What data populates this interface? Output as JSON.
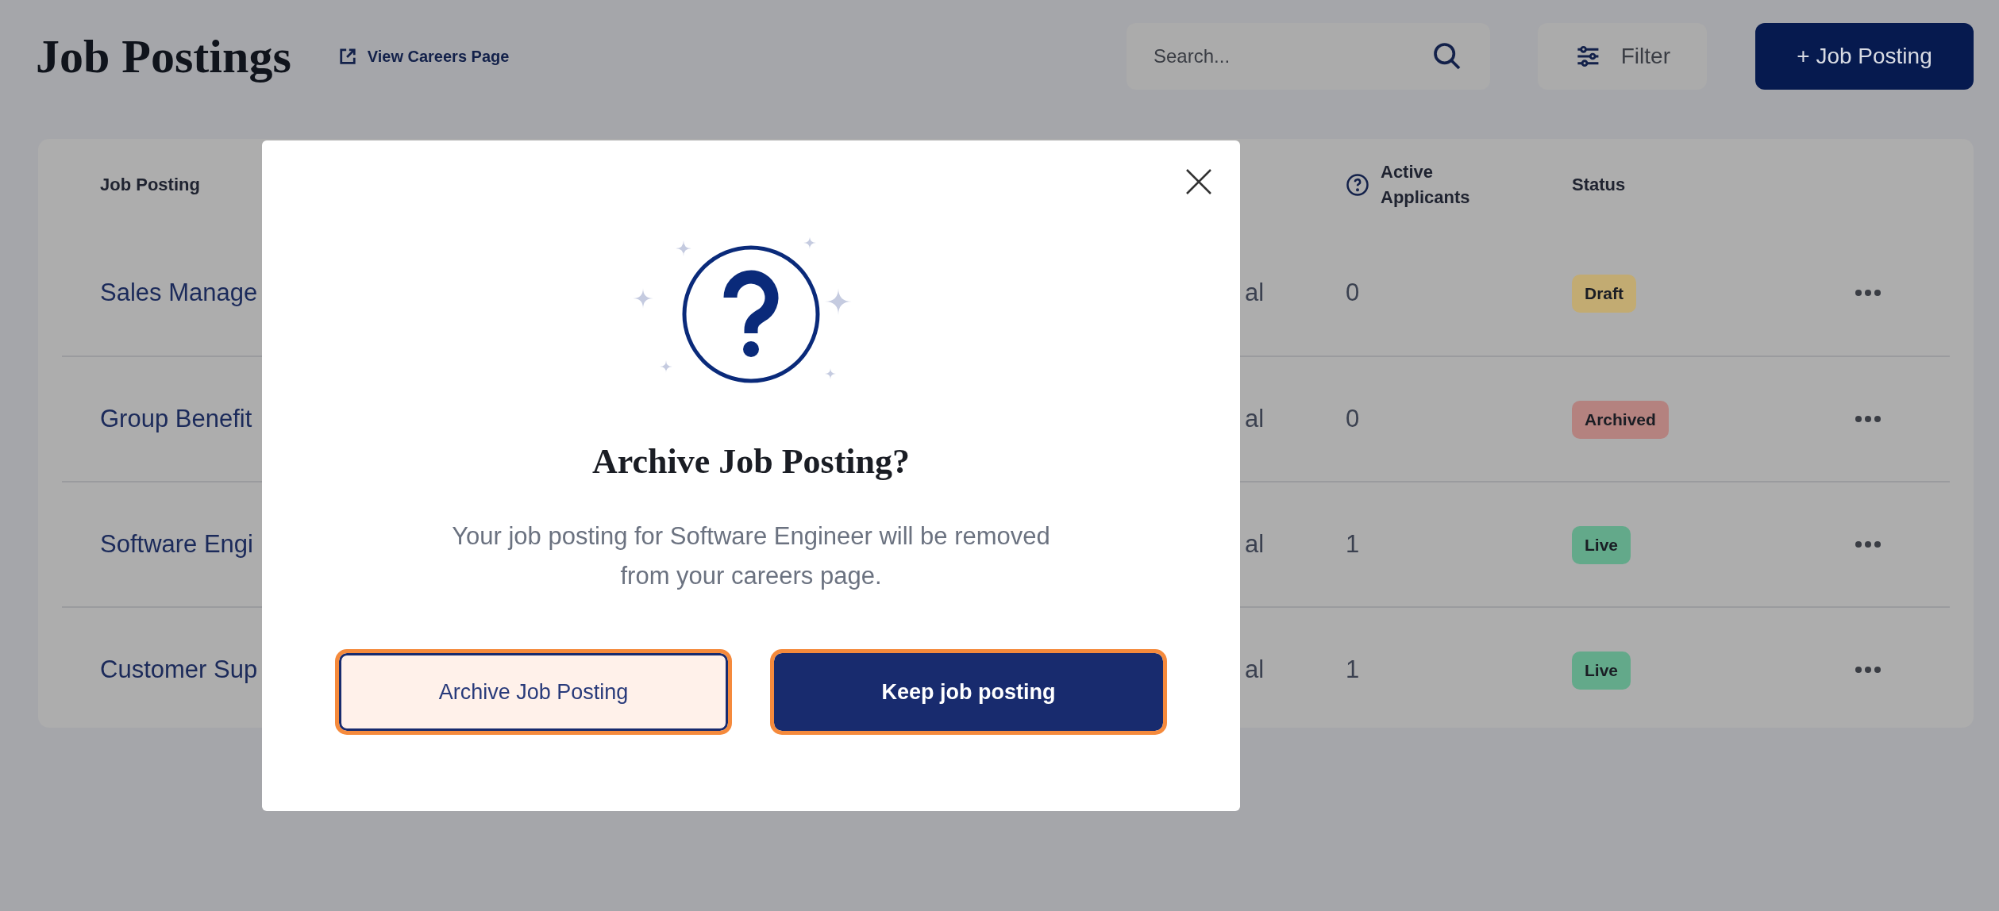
{
  "header": {
    "title": "Job Postings",
    "careers_link": "View Careers Page",
    "search": {
      "placeholder": "Search..."
    },
    "filter_button": "Filter",
    "add_button": "+ Job Posting"
  },
  "table": {
    "columns": [
      {
        "label": "Job Posting",
        "kind": "plain"
      },
      {
        "label": "Active Applicants",
        "kind": "help"
      },
      {
        "label": "Status",
        "kind": "plain"
      }
    ],
    "rows": [
      {
        "job_posting": "Sales Manage",
        "column_2": "al",
        "applicants": "0",
        "status": {
          "label": "Draft",
          "color": "#c2ab72"
        }
      },
      {
        "job_posting": "Group Benefit",
        "column_2": "al",
        "applicants": "0",
        "status": {
          "label": "Archived",
          "color": "#b4827f"
        }
      },
      {
        "job_posting": "Software Engi",
        "column_2": "al",
        "applicants": "1",
        "status": {
          "label": "Live",
          "color": "#63a98a"
        }
      },
      {
        "job_posting": "Customer Sup",
        "column_2": "al",
        "applicants": "1",
        "status": {
          "label": "Live",
          "color": "#63a98a"
        }
      }
    ]
  },
  "dialog": {
    "title": "Archive Job Posting?",
    "message": "Your job posting for Software Engineer will be removed from your careers page.",
    "buttons": [
      {
        "label": "Archive Job Posting",
        "kind": "secondary",
        "highlighted": true
      },
      {
        "label": "Keep job posting",
        "kind": "primary",
        "highlighted": true
      }
    ]
  }
}
